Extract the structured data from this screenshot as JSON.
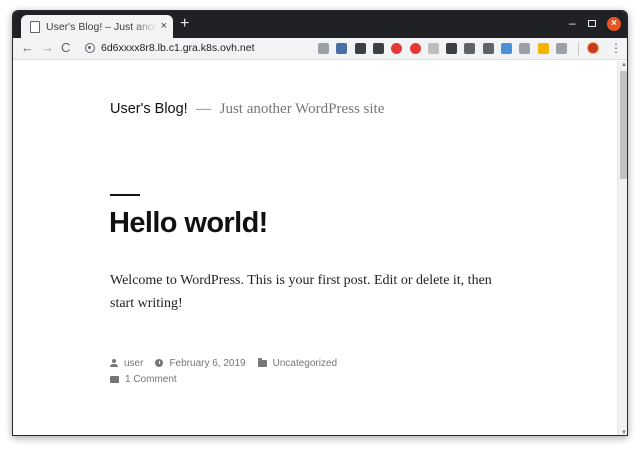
{
  "browser": {
    "tab": {
      "title": "User's Blog! – Just another WordPress site",
      "close_glyph": "×"
    },
    "new_tab_glyph": "+",
    "window_controls": {
      "minimize_glyph": "–",
      "close_glyph": "×"
    },
    "nav": {
      "back_glyph": "←",
      "forward_glyph": "→",
      "reload_glyph": "C"
    },
    "url": "6d6xxxx8r8.lb.c1.gra.k8s.ovh.net",
    "extensions": [
      {
        "name": "shield-ext-icon",
        "color": "#9aa0a6"
      },
      {
        "name": "translate-ext-icon",
        "color": "#4a6fa5"
      },
      {
        "name": "window-ext-icon",
        "color": "#3c4043"
      },
      {
        "name": "glasses-ext-icon",
        "color": "#3c4043"
      },
      {
        "name": "red-a-ext-icon",
        "color": "#e53935"
      },
      {
        "name": "opera-ext-icon",
        "color": "#e53935"
      },
      {
        "name": "page-ext-icon",
        "color": "#bdbdbd"
      },
      {
        "name": "camera-ext-icon",
        "color": "#3c4043"
      },
      {
        "name": "font-ext-icon",
        "color": "#5f6368"
      },
      {
        "name": "ac-ext-icon",
        "color": "#5f6368"
      },
      {
        "name": "monitor-ext-icon",
        "color": "#4a90d9"
      },
      {
        "name": "grid-ext-icon",
        "color": "#9aa0a6"
      },
      {
        "name": "color-ext-icon",
        "color": "#f4b400"
      },
      {
        "name": "v-ext-icon",
        "color": "#9aa0a6"
      }
    ],
    "menu_glyph": "⋮"
  },
  "page": {
    "site_title": "User's Blog!",
    "site_dash": "—",
    "site_description": "Just another WordPress site",
    "post": {
      "title": "Hello world!",
      "content": "Welcome to WordPress. This is your first post. Edit or delete it, then start writing!",
      "author": "user",
      "date": "February 6, 2019",
      "category": "Uncategorized",
      "comments": "1 Comment"
    }
  },
  "colors": {
    "chrome_dark": "#202124",
    "toolbar": "#f1f3f4",
    "accent_close": "#e95420",
    "meta_text": "#767676"
  }
}
